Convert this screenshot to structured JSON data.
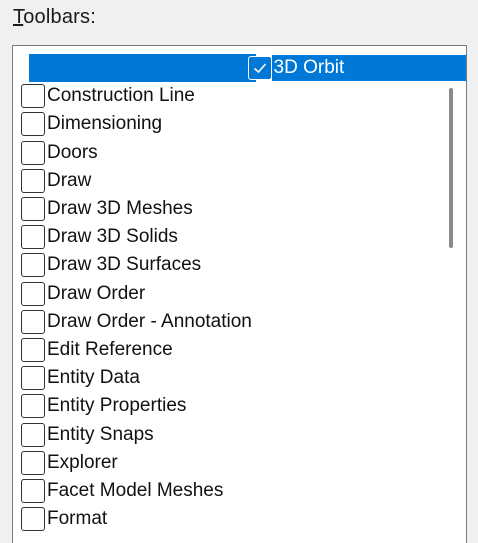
{
  "toolbars": {
    "heading_accel": "T",
    "heading_rest": "oolbars:",
    "items": [
      {
        "label": "3D Orbit",
        "checked": true,
        "selected": true
      },
      {
        "label": "Construction Line",
        "checked": false
      },
      {
        "label": "Dimensioning",
        "checked": false
      },
      {
        "label": "Doors",
        "checked": false
      },
      {
        "label": "Draw",
        "checked": false
      },
      {
        "label": "Draw 3D Meshes",
        "checked": false
      },
      {
        "label": "Draw 3D Solids",
        "checked": false
      },
      {
        "label": "Draw 3D Surfaces",
        "checked": false
      },
      {
        "label": "Draw Order",
        "checked": false
      },
      {
        "label": "Draw Order - Annotation",
        "checked": false
      },
      {
        "label": "Edit Reference",
        "checked": false
      },
      {
        "label": "Entity Data",
        "checked": false
      },
      {
        "label": "Entity Properties",
        "checked": false
      },
      {
        "label": "Entity Snaps",
        "checked": false
      },
      {
        "label": "Explorer",
        "checked": false
      },
      {
        "label": "Facet Model Meshes",
        "checked": false
      },
      {
        "label": "Format",
        "checked": false
      }
    ]
  },
  "colors": {
    "selection": "#0078d7",
    "panel_bg": "#f0f0f0",
    "list_bg": "#ffffff"
  },
  "icons": {
    "check": "checkmark-icon"
  }
}
